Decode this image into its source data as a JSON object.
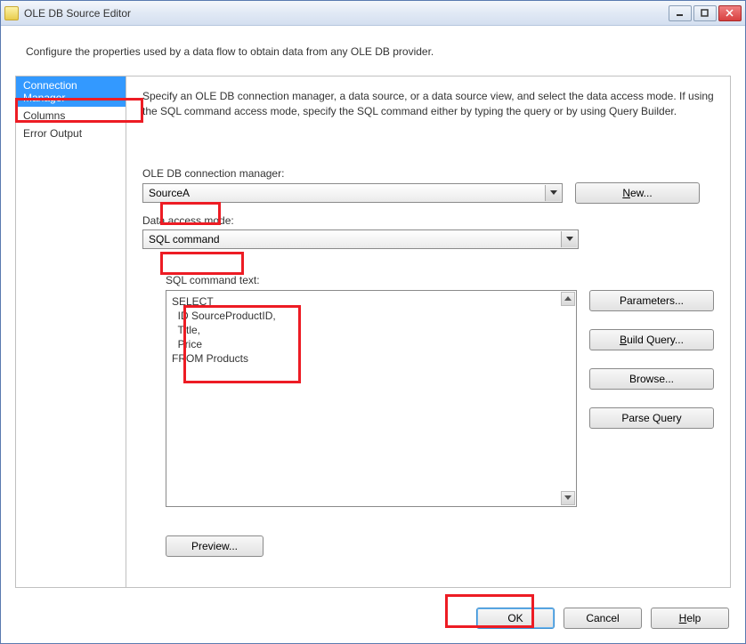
{
  "window": {
    "title": "OLE DB Source Editor"
  },
  "subtitle": "Configure the properties used by a data flow to obtain data from any OLE DB provider.",
  "sidebar": {
    "items": [
      {
        "label": "Connection Manager"
      },
      {
        "label": "Columns"
      },
      {
        "label": "Error Output"
      }
    ]
  },
  "content": {
    "description": "Specify an OLE DB connection manager, a data source, or a data source view, and select the data access mode. If using the SQL command access mode, specify the SQL command either by typing the query or by using Query Builder.",
    "conn_label": "OLE DB connection manager:",
    "conn_value": "SourceA",
    "new_btn_u": "N",
    "new_btn_rest": "ew...",
    "dam_label": "Data access mode:",
    "dam_value": "SQL command",
    "sql_label": "SQL command text:",
    "sql_text": "SELECT\n  ID SourceProductID,\n  Title,\n  Price\nFROM Products",
    "parameters_btn": "Parameters...",
    "build_query_u": "B",
    "build_query_rest": "uild Query...",
    "browse_btn": "Browse...",
    "parse_query_btn": "Parse Query",
    "preview_btn": "Preview..."
  },
  "footer": {
    "ok": "OK",
    "cancel": "Cancel",
    "help_u": "H",
    "help_rest": "elp"
  }
}
